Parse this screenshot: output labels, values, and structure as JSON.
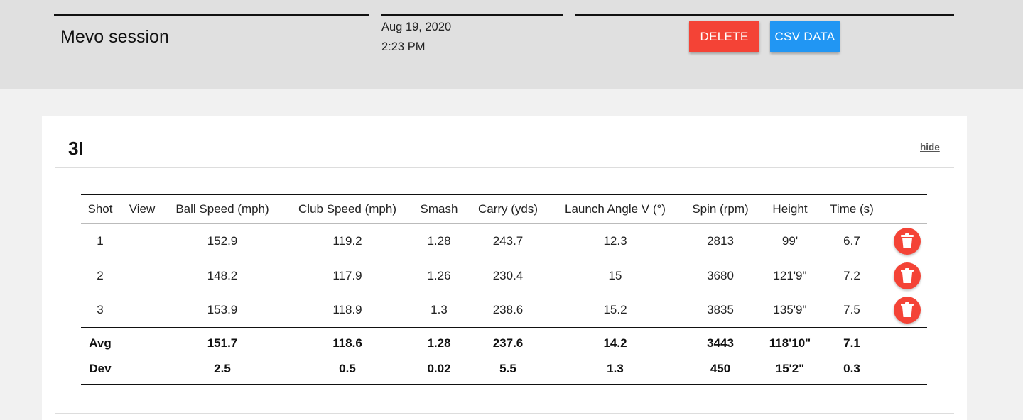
{
  "session": {
    "name": "Mevo session",
    "date": "Aug 19, 2020",
    "time": "2:23 PM"
  },
  "actions": {
    "delete_label": "DELETE",
    "csv_label": "CSV DATA"
  },
  "colors": {
    "delete": "#f44336",
    "csv": "#2196f3"
  },
  "club": {
    "title": "3I",
    "hide_label": "hide"
  },
  "table": {
    "columns": [
      "Shot",
      "View",
      "Ball Speed (mph)",
      "Club Speed (mph)",
      "Smash",
      "Carry (yds)",
      "Launch Angle V (°)",
      "Spin (rpm)",
      "Height",
      "Time (s)"
    ],
    "rows": [
      {
        "shot": "1",
        "ball_speed": "152.9",
        "club_speed": "119.2",
        "smash": "1.28",
        "carry": "243.7",
        "launch_v": "12.3",
        "spin": "2813",
        "height": "99'",
        "time": "6.7",
        "action_icon": "trash-icon"
      },
      {
        "shot": "2",
        "ball_speed": "148.2",
        "club_speed": "117.9",
        "smash": "1.26",
        "carry": "230.4",
        "launch_v": "15",
        "spin": "3680",
        "height": "121'9\"",
        "time": "7.2",
        "action_icon": "trash-icon"
      },
      {
        "shot": "3",
        "ball_speed": "153.9",
        "club_speed": "118.9",
        "smash": "1.3",
        "carry": "238.6",
        "launch_v": "15.2",
        "spin": "3835",
        "height": "135'9\"",
        "time": "7.5",
        "action_icon": "trash-icon"
      }
    ],
    "avg": {
      "label": "Avg",
      "ball_speed": "151.7",
      "club_speed": "118.6",
      "smash": "1.28",
      "carry": "237.6",
      "launch_v": "14.2",
      "spin": "3443",
      "height": "118'10\"",
      "time": "7.1"
    },
    "dev": {
      "label": "Dev",
      "ball_speed": "2.5",
      "club_speed": "0.5",
      "smash": "0.02",
      "carry": "5.5",
      "launch_v": "1.3",
      "spin": "450",
      "height": "15'2\"",
      "time": "0.3"
    }
  }
}
